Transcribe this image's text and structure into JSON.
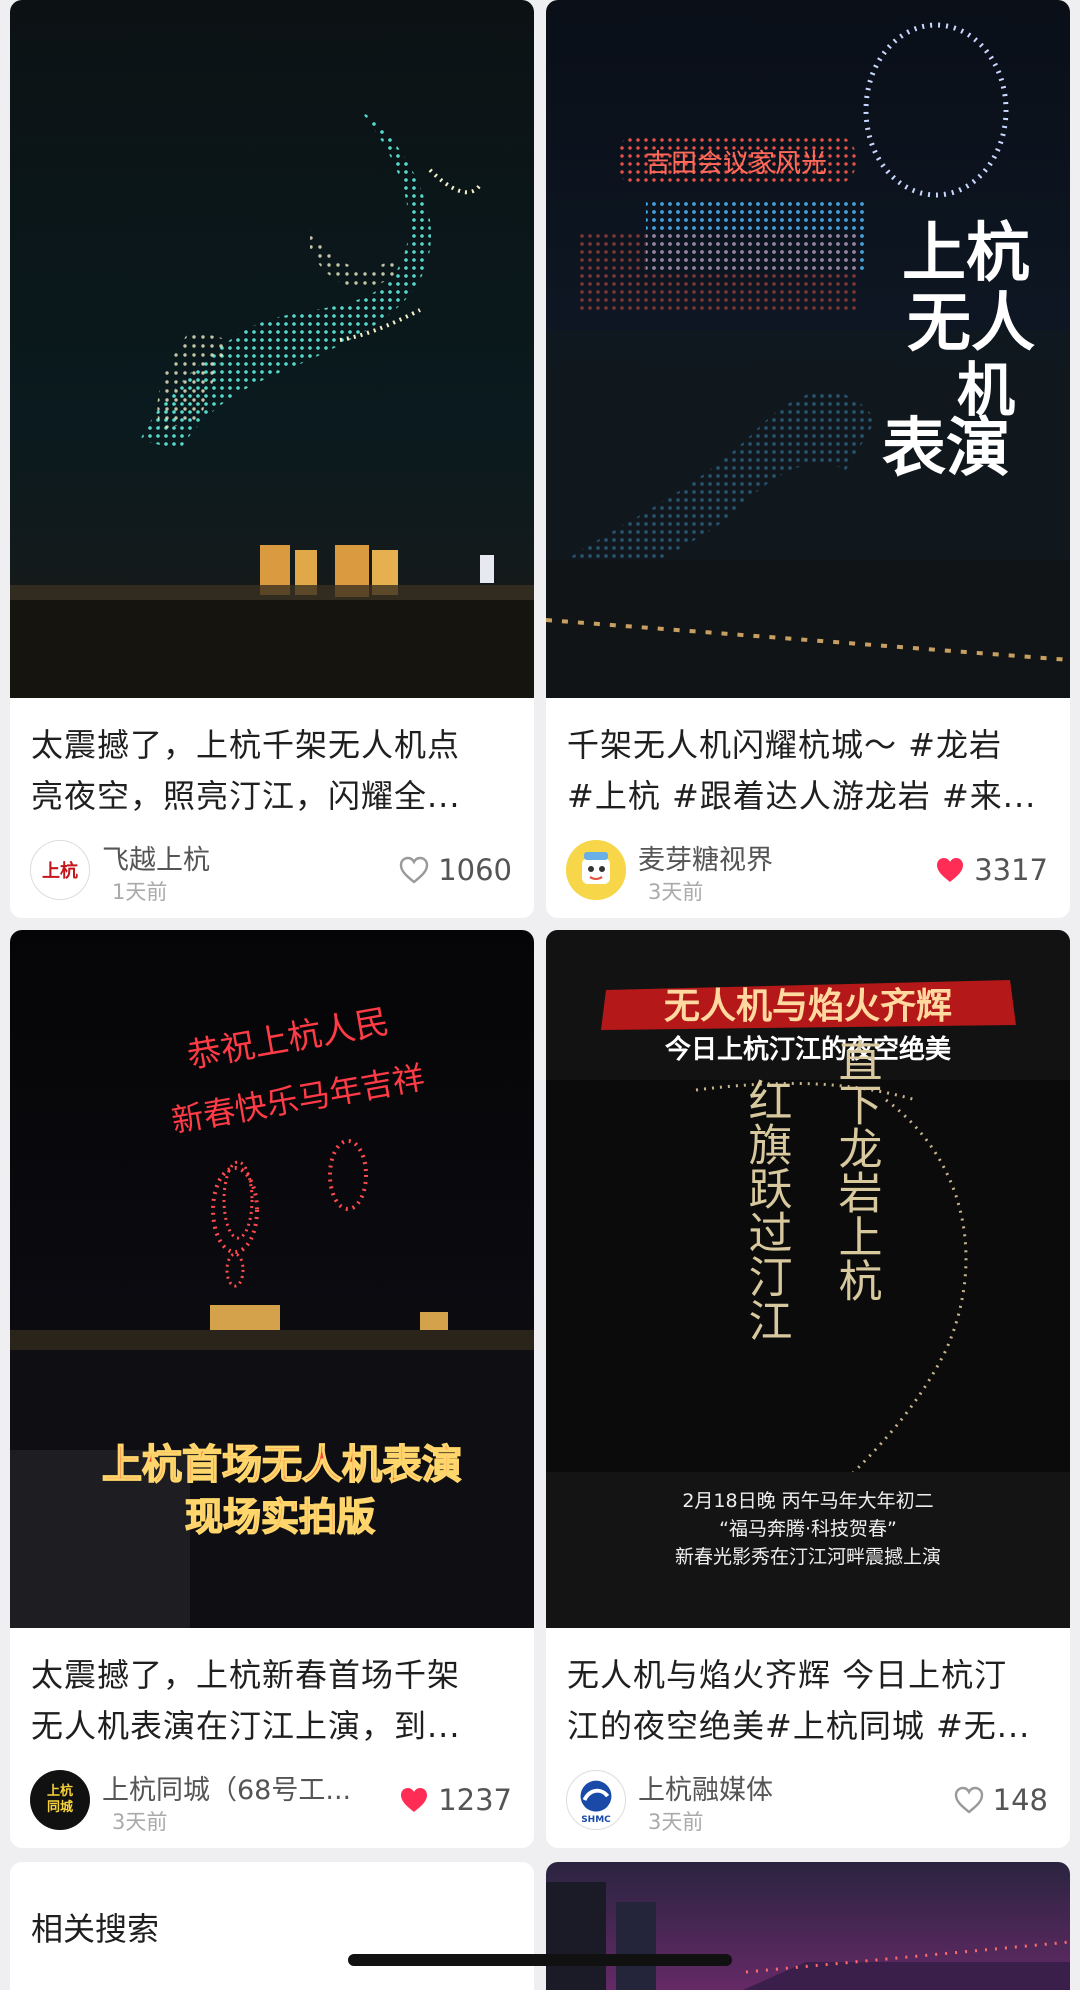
{
  "feed": {
    "cards": [
      {
        "title_line1": "太震撼了，上杭千架无人机点",
        "title_line2": "亮夜空，照亮汀江，闪耀全...",
        "author": "飞越上杭",
        "time": "1天前",
        "likes": "1060",
        "liked": false,
        "avatar_text": "上杭"
      },
      {
        "title_line1": "千架无人机闪耀杭城～ #龙岩",
        "title_line2": "#上杭 #跟着达人游龙岩 #来...",
        "author": "麦芽糖视界",
        "time": "3天前",
        "likes": "3317",
        "liked": true,
        "image_text": [
          "上杭",
          "无人",
          "机",
          "表演"
        ],
        "image_banner": "吉田会议家风光"
      },
      {
        "title_line1": "太震撼了，上杭新春首场千架",
        "title_line2": "无人机表演在汀江上演，到...",
        "author": "上杭同城（68号工...",
        "time": "3天前",
        "likes": "1237",
        "liked": true,
        "avatar_text": "上杭同城",
        "image_text": [
          "恭祝上杭人民",
          "新春快乐马年吉祥",
          "上杭首场无人机表演",
          "现场实拍版"
        ]
      },
      {
        "title_line1": "无人机与焰火齐辉 今日上杭汀",
        "title_line2": "江的夜空绝美#上杭同城 #无...",
        "author": "上杭融媒体",
        "time": "3天前",
        "likes": "148",
        "liked": false,
        "avatar_text": "SHMC",
        "image_text": [
          "无人机与焰火齐辉",
          "今日上杭汀江的夜空绝美",
          "红旗跃过汀江",
          "直下龙岩上杭",
          "2月18日晚 丙午马年大年初二",
          "“福马奔腾·科技贺春”",
          "新春光影秀在汀江河畔震撼上演"
        ]
      }
    ],
    "related_search_label": "相关搜索"
  },
  "colors": {
    "like_active": "#ff2d55",
    "like_inactive": "#9a9a9a"
  }
}
